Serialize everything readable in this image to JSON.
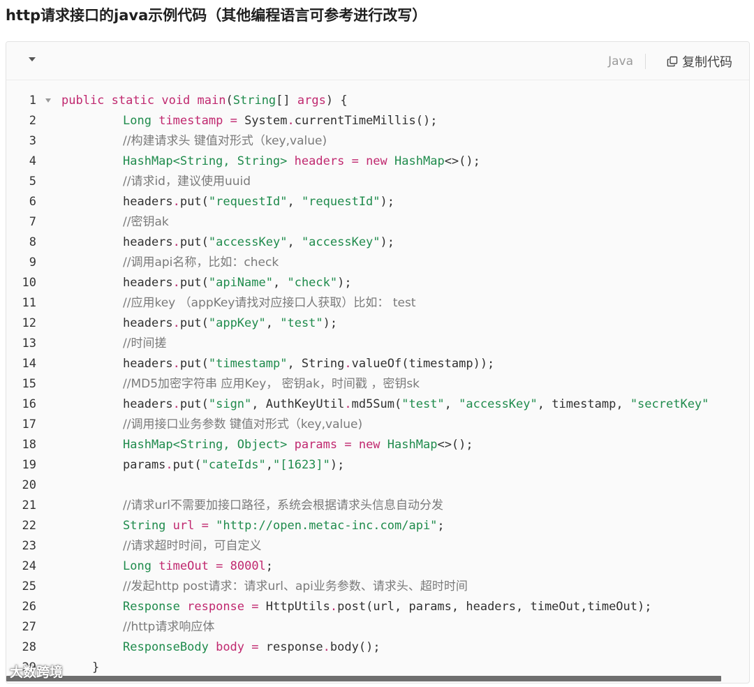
{
  "page": {
    "title": "http请求接口的java示例代码（其他编程语言可参考进行改写）"
  },
  "code_block": {
    "language": "Java",
    "copy_label": "复制代码",
    "lines": [
      {
        "n": "1",
        "fold": true,
        "indent": "none",
        "tokens": [
          [
            "kw",
            "public"
          ],
          [
            "pl",
            " "
          ],
          [
            "kw",
            "static"
          ],
          [
            "pl",
            " "
          ],
          [
            "kw",
            "void"
          ],
          [
            "pl",
            " "
          ],
          [
            "vn",
            "main"
          ],
          [
            "pl",
            "("
          ],
          [
            "ty",
            "String"
          ],
          [
            "pl",
            "[] "
          ],
          [
            "vn",
            "args"
          ],
          [
            "pl",
            ") {"
          ]
        ]
      },
      {
        "n": "2",
        "indent": "ind",
        "tokens": [
          [
            "ty",
            "Long"
          ],
          [
            "pl",
            " "
          ],
          [
            "vn",
            "timestamp"
          ],
          [
            "pl",
            " "
          ],
          [
            "op",
            "="
          ],
          [
            "pl",
            " System"
          ],
          [
            "op",
            "."
          ],
          [
            "pl",
            "currentTimeMillis();"
          ]
        ]
      },
      {
        "n": "3",
        "indent": "ind",
        "tokens": [
          [
            "cm",
            "//构建请求头 键值对形式（key,value)"
          ]
        ]
      },
      {
        "n": "4",
        "indent": "ind",
        "tokens": [
          [
            "ty",
            "HashMap<String, String>"
          ],
          [
            "pl",
            " "
          ],
          [
            "vn",
            "headers"
          ],
          [
            "pl",
            " "
          ],
          [
            "op",
            "="
          ],
          [
            "pl",
            " "
          ],
          [
            "kw",
            "new"
          ],
          [
            "pl",
            " "
          ],
          [
            "ty",
            "HashMap"
          ],
          [
            "pl",
            "<>();"
          ]
        ]
      },
      {
        "n": "5",
        "indent": "ind",
        "tokens": [
          [
            "cm",
            "//请求id，建议使用uuid"
          ]
        ]
      },
      {
        "n": "6",
        "indent": "ind",
        "tokens": [
          [
            "pl",
            "headers"
          ],
          [
            "op",
            "."
          ],
          [
            "pl",
            "put("
          ],
          [
            "str",
            "\"requestId\""
          ],
          [
            "pl",
            ", "
          ],
          [
            "str",
            "\"requestId\""
          ],
          [
            "pl",
            ");"
          ]
        ]
      },
      {
        "n": "7",
        "indent": "ind",
        "tokens": [
          [
            "cm",
            "//密钥ak"
          ]
        ]
      },
      {
        "n": "8",
        "indent": "ind",
        "tokens": [
          [
            "pl",
            "headers"
          ],
          [
            "op",
            "."
          ],
          [
            "pl",
            "put("
          ],
          [
            "str",
            "\"accessKey\""
          ],
          [
            "pl",
            ", "
          ],
          [
            "str",
            "\"accessKey\""
          ],
          [
            "pl",
            ");"
          ]
        ]
      },
      {
        "n": "9",
        "indent": "ind",
        "tokens": [
          [
            "cm",
            "//调用api名称，比如：check"
          ]
        ]
      },
      {
        "n": "10",
        "indent": "ind",
        "tokens": [
          [
            "pl",
            "headers"
          ],
          [
            "op",
            "."
          ],
          [
            "pl",
            "put("
          ],
          [
            "str",
            "\"apiName\""
          ],
          [
            "pl",
            ", "
          ],
          [
            "str",
            "\"check\""
          ],
          [
            "pl",
            ");"
          ]
        ]
      },
      {
        "n": "11",
        "indent": "ind",
        "tokens": [
          [
            "cm",
            "//应用key （appKey请找对应接口人获取）比如： test"
          ]
        ]
      },
      {
        "n": "12",
        "indent": "ind",
        "tokens": [
          [
            "pl",
            "headers"
          ],
          [
            "op",
            "."
          ],
          [
            "pl",
            "put("
          ],
          [
            "str",
            "\"appKey\""
          ],
          [
            "pl",
            ", "
          ],
          [
            "str",
            "\"test\""
          ],
          [
            "pl",
            ");"
          ]
        ]
      },
      {
        "n": "13",
        "indent": "ind",
        "tokens": [
          [
            "cm",
            "//时间搓"
          ]
        ]
      },
      {
        "n": "14",
        "indent": "ind",
        "tokens": [
          [
            "pl",
            "headers"
          ],
          [
            "op",
            "."
          ],
          [
            "pl",
            "put("
          ],
          [
            "str",
            "\"timestamp\""
          ],
          [
            "pl",
            ", String"
          ],
          [
            "op",
            "."
          ],
          [
            "pl",
            "valueOf(timestamp));"
          ]
        ]
      },
      {
        "n": "15",
        "indent": "ind",
        "tokens": [
          [
            "cm",
            "//MD5加密字符串 应用Key， 密钥ak，时间戳 ，密钥sk"
          ]
        ]
      },
      {
        "n": "16",
        "indent": "ind",
        "tokens": [
          [
            "pl",
            "headers"
          ],
          [
            "op",
            "."
          ],
          [
            "pl",
            "put("
          ],
          [
            "str",
            "\"sign\""
          ],
          [
            "pl",
            ", AuthKeyUtil"
          ],
          [
            "op",
            "."
          ],
          [
            "pl",
            "md5Sum("
          ],
          [
            "str",
            "\"test\""
          ],
          [
            "pl",
            ", "
          ],
          [
            "str",
            "\"accessKey\""
          ],
          [
            "pl",
            ", timestamp, "
          ],
          [
            "str",
            "\"secretKey\""
          ]
        ]
      },
      {
        "n": "17",
        "indent": "ind",
        "tokens": [
          [
            "cm",
            "//调用接口业务参数 键值对形式（key,value)"
          ]
        ]
      },
      {
        "n": "18",
        "indent": "ind",
        "tokens": [
          [
            "ty",
            "HashMap<String, Object>"
          ],
          [
            "pl",
            " "
          ],
          [
            "vn",
            "params"
          ],
          [
            "pl",
            " "
          ],
          [
            "op",
            "="
          ],
          [
            "pl",
            " "
          ],
          [
            "kw",
            "new"
          ],
          [
            "pl",
            " "
          ],
          [
            "ty",
            "HashMap"
          ],
          [
            "pl",
            "<>();"
          ]
        ]
      },
      {
        "n": "19",
        "indent": "ind",
        "tokens": [
          [
            "pl",
            "params"
          ],
          [
            "op",
            "."
          ],
          [
            "pl",
            "put("
          ],
          [
            "str",
            "\"cateIds\""
          ],
          [
            "pl",
            ","
          ],
          [
            "str",
            "\"[1623]\""
          ],
          [
            "pl",
            ");"
          ]
        ]
      },
      {
        "n": "20",
        "indent": "ind",
        "tokens": []
      },
      {
        "n": "21",
        "indent": "ind",
        "tokens": [
          [
            "cm",
            "//请求url不需要加接口路径，系统会根据请求头信息自动分发"
          ]
        ]
      },
      {
        "n": "22",
        "indent": "ind",
        "tokens": [
          [
            "ty",
            "String"
          ],
          [
            "pl",
            " "
          ],
          [
            "vn",
            "url"
          ],
          [
            "pl",
            " "
          ],
          [
            "op",
            "="
          ],
          [
            "pl",
            " "
          ],
          [
            "str",
            "\"http://open.metac-inc.com/api\""
          ],
          [
            "pl",
            ";"
          ]
        ]
      },
      {
        "n": "23",
        "indent": "ind",
        "tokens": [
          [
            "cm",
            "//请求超时时间，可自定义"
          ]
        ]
      },
      {
        "n": "24",
        "indent": "ind",
        "tokens": [
          [
            "ty",
            "Long"
          ],
          [
            "pl",
            " "
          ],
          [
            "vn",
            "timeOut"
          ],
          [
            "pl",
            " "
          ],
          [
            "op",
            "="
          ],
          [
            "pl",
            " "
          ],
          [
            "num",
            "8000l"
          ],
          [
            "pl",
            ";"
          ]
        ]
      },
      {
        "n": "25",
        "indent": "ind",
        "tokens": [
          [
            "cm",
            "//发起http post请求：请求url、api业务参数、请求头、超时时间"
          ]
        ]
      },
      {
        "n": "26",
        "indent": "ind",
        "tokens": [
          [
            "ty",
            "Response"
          ],
          [
            "pl",
            " "
          ],
          [
            "vn",
            "response"
          ],
          [
            "pl",
            " "
          ],
          [
            "op",
            "="
          ],
          [
            "pl",
            " HttpUtils"
          ],
          [
            "op",
            "."
          ],
          [
            "pl",
            "post(url, params, headers, timeOut,timeOut);"
          ]
        ]
      },
      {
        "n": "27",
        "indent": "ind",
        "tokens": [
          [
            "cm",
            "//http请求响应体"
          ]
        ]
      },
      {
        "n": "28",
        "indent": "ind",
        "tokens": [
          [
            "ty",
            "ResponseBody"
          ],
          [
            "pl",
            " "
          ],
          [
            "vn",
            "body"
          ],
          [
            "pl",
            " "
          ],
          [
            "op",
            "="
          ],
          [
            "pl",
            " response"
          ],
          [
            "op",
            "."
          ],
          [
            "pl",
            "body();"
          ]
        ]
      },
      {
        "n": "29",
        "indent": "close",
        "tokens": [
          [
            "pl",
            "}"
          ]
        ]
      }
    ]
  },
  "watermark": "大数跨境",
  "colors": {
    "keyword": "#c0286f",
    "type": "#1f8b4c",
    "string": "#1f8b4c",
    "comment": "#7a7a7a"
  }
}
